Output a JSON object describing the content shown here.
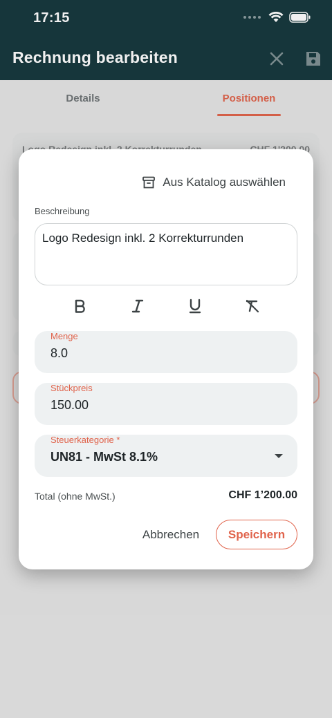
{
  "status": {
    "time": "17:15"
  },
  "appbar": {
    "title": "Rechnung bearbeiten"
  },
  "tabs": [
    {
      "label": "Details",
      "active": false
    },
    {
      "label": "Positionen",
      "active": true
    }
  ],
  "background_list": {
    "item_title": "Logo Redesign inkl. 2 Korrekturrunden",
    "item_amount": "CHF 1'200.00"
  },
  "dialog": {
    "catalog_button": "Aus Katalog auswählen",
    "description_label": "Beschreibung",
    "description_value": "Logo Redesign inkl. 2 Korrekturrunden",
    "formatting": [
      "bold-icon",
      "italic-icon",
      "underline-icon",
      "clear-format-icon"
    ],
    "quantity": {
      "label": "Menge",
      "value": "8.0"
    },
    "unit_price": {
      "label": "Stückpreis",
      "value": "150.00"
    },
    "tax_category": {
      "label": "Steuerkategorie *",
      "value": "UN81 - MwSt 8.1%"
    },
    "total_label": "Total (ohne MwSt.)",
    "total_value": "CHF 1’200.00",
    "cancel_label": "Abbrechen",
    "save_label": "Speichern"
  },
  "colors": {
    "header_bg": "#15373d",
    "accent": "#e0634b",
    "field_bg": "#eef1f2"
  }
}
